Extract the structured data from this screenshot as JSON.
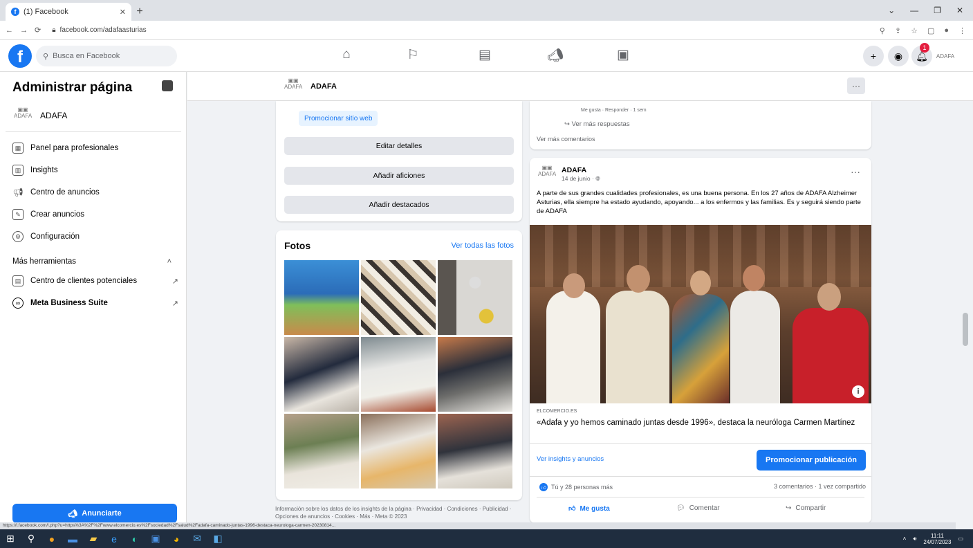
{
  "browser": {
    "tab_title": "(1) Facebook",
    "url": "facebook.com/adafaasturias",
    "status_url": "https://l.facebook.com/l.php?u=https%3A%2F%2Fwww.elcomercio.es%2Fsociedad%2Fsalud%2Fadafa-caminado-juntas-1996-destaca-neurologa-carmen-20230814..."
  },
  "fbnav": {
    "search_placeholder": "Busca en Facebook",
    "notif_count": "1",
    "avatar_text": "ADAFA"
  },
  "sidebar": {
    "title": "Administrar página",
    "page_name": "ADAFA",
    "items": [
      {
        "label": "Panel para profesionales",
        "icon": "dashboard-icon"
      },
      {
        "label": "Insights",
        "icon": "insights-icon"
      },
      {
        "label": "Centro de anuncios",
        "icon": "megaphone-icon"
      },
      {
        "label": "Crear anuncios",
        "icon": "edit-icon"
      },
      {
        "label": "Configuración",
        "icon": "gear-icon"
      }
    ],
    "more_tools": "Más herramientas",
    "tools": [
      {
        "label": "Centro de clientes potenciales",
        "icon": "leads-icon"
      },
      {
        "label": "Meta Business Suite",
        "icon": "meta-icon"
      }
    ],
    "advertise_button": "Anunciarte"
  },
  "page_header": {
    "name": "ADAFA",
    "more": "···"
  },
  "intro_card": {
    "promote_site": "Promocionar sitio web",
    "buttons": [
      "Editar detalles",
      "Añadir aficiones",
      "Añadir destacados"
    ]
  },
  "photos": {
    "title": "Fotos",
    "see_all": "Ver todas las fotos"
  },
  "footer_info": "Información sobre los datos de los insights de la página · Privacidad · Condiciones · Publicidad · Opciones de anuncios · Cookies · Más · Meta © 2023",
  "comments": {
    "fragment": "Me gusta · Responder · 1 sem",
    "more_replies": "Ver más respuestas",
    "more_comments": "Ver más comentarios"
  },
  "post": {
    "author": "ADAFA",
    "date": "14 de junio · ",
    "text": "A parte de sus grandes cualidades profesionales, es una buena persona. En los 27 años de ADAFA Alzheimer Asturias, ella siempre ha estado ayudando, apoyando... a los enfermos y las familias. Es y seguirá siendo parte de ADAFA",
    "link_domain": "ELCOMERCIO.ES",
    "link_title": "«Adafa y yo hemos caminado juntas desde 1996», destaca la neuróloga Carmen Martínez",
    "insights_link": "Ver insights y anuncios",
    "promote_button": "Promocionar publicación",
    "reactions": "Tú y 28 personas más",
    "counts": "3 comentarios · 1 vez compartido",
    "actions": [
      "Me gusta",
      "Comentar",
      "Compartir"
    ]
  },
  "taskbar": {
    "time": "11:11",
    "date": "24/07/2023"
  },
  "colors": {
    "accent": "#1877f2",
    "badge": "#e41e3f"
  }
}
